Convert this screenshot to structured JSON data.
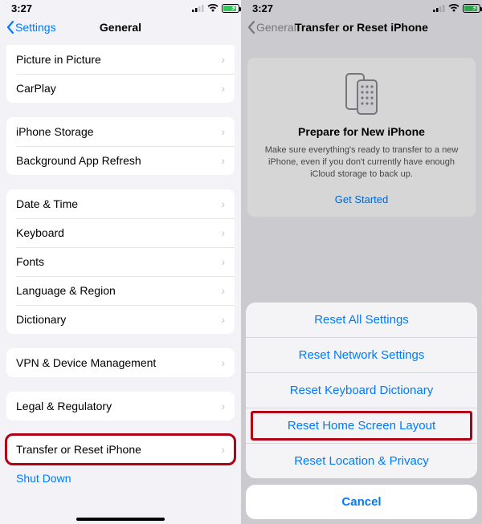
{
  "status": {
    "time": "3:27"
  },
  "left": {
    "back": "Settings",
    "title": "General",
    "group1": [
      "Picture in Picture",
      "CarPlay"
    ],
    "group2": [
      "iPhone Storage",
      "Background App Refresh"
    ],
    "group3": [
      "Date & Time",
      "Keyboard",
      "Fonts",
      "Language & Region",
      "Dictionary"
    ],
    "group4": [
      "VPN & Device Management"
    ],
    "group5": [
      "Legal & Regulatory"
    ],
    "group6": [
      "Transfer or Reset iPhone"
    ],
    "shutdown": "Shut Down"
  },
  "right": {
    "back": "General",
    "title": "Transfer or Reset iPhone",
    "promo": {
      "heading": "Prepare for New iPhone",
      "body": "Make sure everything's ready to transfer to a new iPhone, even if you don't currently have enough iCloud storage to back up.",
      "cta": "Get Started"
    },
    "sheet": {
      "items": [
        "Reset All Settings",
        "Reset Network Settings",
        "Reset Keyboard Dictionary",
        "Reset Home Screen Layout",
        "Reset Location & Privacy"
      ],
      "cancel": "Cancel"
    }
  }
}
